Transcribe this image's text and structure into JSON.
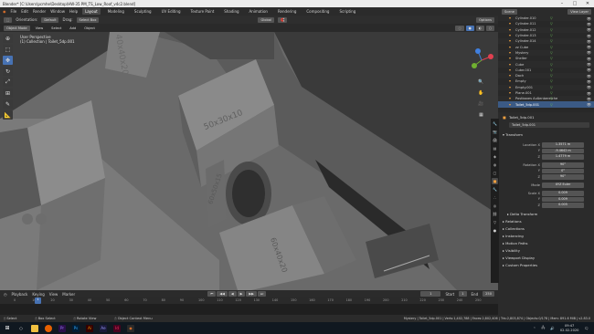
{
  "window": {
    "title": "Blender* [C:\\Users\\pcmhe\\Desktop\\HW-35 PM_TS_Low_Roof_v4c2.blend]"
  },
  "menu": {
    "items": [
      "File",
      "Edit",
      "Render",
      "Window",
      "Help"
    ],
    "workspaces": [
      "Layout",
      "Modeling",
      "Sculpting",
      "UV Editing",
      "Texture Paint",
      "Shading",
      "Animation",
      "Rendering",
      "Compositing",
      "Scripting"
    ],
    "active_workspace": "Layout",
    "scene": "Scene",
    "view_layer": "View Layer"
  },
  "tool_header": {
    "orientation_label": "Orientation:",
    "orientation_value": "Default",
    "drag_label": "Drag:",
    "drag_value": "Select Box",
    "transform": "Global",
    "options": "Options"
  },
  "viewport_header": {
    "mode": "Object Mode",
    "view": "View",
    "select": "Select",
    "add": "Add",
    "object": "Object"
  },
  "viewport_info": {
    "line1": "User Perspective",
    "line2": "(1) Collection | Toilet_5dp.001"
  },
  "viewport_labels": {
    "l1": "50x30x10",
    "l2": "60x50x15",
    "l3": "60x40x20",
    "l4": "40x40x20"
  },
  "toolbar": {
    "icons": [
      "cursor-icon",
      "select-icon",
      "move-icon",
      "rotate-icon",
      "scale-icon",
      "transform-icon",
      "annotate-icon",
      "measure-icon"
    ]
  },
  "outliner": {
    "rows": [
      {
        "name": "Cylinder.010",
        "icon": "▽"
      },
      {
        "name": "Cylinder.011",
        "icon": "▽"
      },
      {
        "name": "Cylinder.012",
        "icon": "▽"
      },
      {
        "name": "Cylinder.013",
        "icon": "▽"
      },
      {
        "name": "Cylinder.014",
        "icon": "▽"
      },
      {
        "name": "zz Cube",
        "icon": "▽"
      },
      {
        "name": "Mystery",
        "icon": "▽"
      },
      {
        "name": "Shelter",
        "icon": "▽"
      },
      {
        "name": "Cube",
        "icon": "▽"
      },
      {
        "name": "Cube.001",
        "icon": "▽"
      },
      {
        "name": "Dach",
        "icon": "▽"
      },
      {
        "name": "Empty",
        "icon": "▽"
      },
      {
        "name": "Empty.001",
        "icon": "▽"
      },
      {
        "name": "Plane.001",
        "icon": "▽"
      },
      {
        "name": "Postboxes Außenbereiche",
        "icon": "▽"
      },
      {
        "name": "Toilet_5dp.001",
        "icon": "▽"
      }
    ]
  },
  "properties": {
    "object_name": "Toilet_5dp.001",
    "object_field": "Toilet_5dp.001",
    "transform_label": "Transform",
    "location": {
      "label": "Location X",
      "x": "1.3571 m",
      "y": "-9.4642 m",
      "z": "1.4779 m"
    },
    "rotation": {
      "label": "Rotation X",
      "x": "90°",
      "y": "0°",
      "z": "90°"
    },
    "mode_label": "Mode",
    "mode_value": "XYZ Euler",
    "scale": {
      "label": "Scale X",
      "x": "0.009",
      "y": "0.009",
      "z": "0.005"
    },
    "delta_transform": "Delta Transform",
    "sections": [
      "Relations",
      "Collections",
      "Instancing",
      "Motion Paths",
      "Visibility",
      "Viewport Display",
      "Custom Properties"
    ]
  },
  "timeline": {
    "menu": [
      "Playback",
      "Keying",
      "View",
      "Marker"
    ],
    "current_frame": "1",
    "start_label": "Start",
    "start": "1",
    "end_label": "End",
    "end": "250",
    "ticks": [
      "0",
      "10",
      "20",
      "30",
      "40",
      "50",
      "60",
      "70",
      "80",
      "90",
      "100",
      "110",
      "120",
      "130",
      "140",
      "150",
      "160",
      "170",
      "180",
      "190",
      "200",
      "210",
      "220",
      "230",
      "240",
      "250"
    ]
  },
  "statusbar": {
    "select": "Select",
    "box_select": "Box Select",
    "rotate_view": "Rotate View",
    "object_context": "Object Context Menu",
    "info": "Mystery | Toilet_5dp.001 | Verts:1,402,788 | Faces:2,802,406 | Tris:2,803,874 | Objects:0/178 | Mem: 891.6 MiB | v2.83.0"
  },
  "taskbar": {
    "clock": "09:47",
    "date": "02.02.2020",
    "apps": [
      {
        "name": "start",
        "color": "#ffffff"
      },
      {
        "name": "search",
        "color": "#ffffff"
      },
      {
        "name": "explorer",
        "color": "#f0c040"
      },
      {
        "name": "firefox",
        "color": "#e66000"
      },
      {
        "name": "premiere",
        "color": "#9a7cff"
      },
      {
        "name": "photoshop",
        "color": "#31a8ff"
      },
      {
        "name": "illustrator",
        "color": "#ff9a00"
      },
      {
        "name": "after-effects",
        "color": "#9999ff"
      },
      {
        "name": "indesign",
        "color": "#ff3366"
      },
      {
        "name": "blender",
        "color": "#f5792a"
      }
    ]
  }
}
